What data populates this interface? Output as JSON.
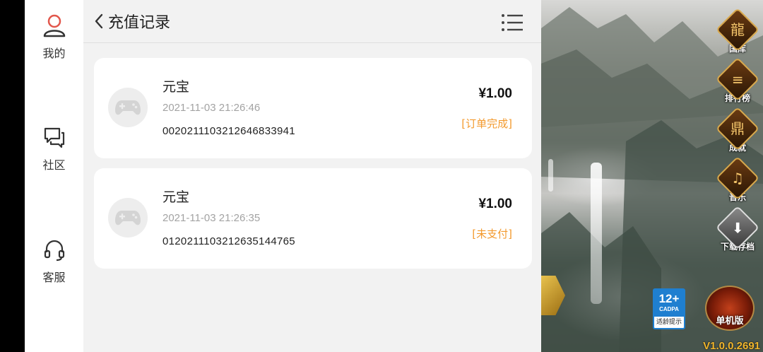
{
  "sidebar": {
    "items": [
      {
        "label": "我的",
        "icon": "user-icon"
      },
      {
        "label": "社区",
        "icon": "chat-icon"
      },
      {
        "label": "客服",
        "icon": "headset-icon"
      }
    ]
  },
  "header": {
    "title": "充值记录",
    "back_icon": "chevron-left-icon",
    "menu_icon": "list-menu-icon"
  },
  "records": [
    {
      "name": "元宝",
      "time": "2021-11-03 21:26:46",
      "order_no": "002021110321264 6833941",
      "amount": "¥1.00",
      "status": "[订单完成]"
    },
    {
      "name": "元宝",
      "time": "2021-11-03 21:26:35",
      "order_no": "012021110321263 5144765",
      "amount": "¥1.00",
      "status": "[未支付]"
    }
  ],
  "game_panel": {
    "buttons": [
      {
        "label": "国库",
        "icon": "treasury-icon"
      },
      {
        "label": "排行榜",
        "icon": "rank-icon"
      },
      {
        "label": "成就",
        "icon": "achievement-icon"
      },
      {
        "label": "音乐",
        "icon": "music-icon"
      },
      {
        "label": "下载存档",
        "icon": "download-icon"
      }
    ],
    "age_rating": "12+",
    "age_org": "CADPA",
    "age_tip": "适龄提示",
    "standalone_label": "单机版",
    "version": "V1.0.0.2691"
  },
  "colors": {
    "status_orange": "#f39a2e",
    "page_bg": "#f2f2f2",
    "card_bg": "#ffffff",
    "gold": "#f0b52c"
  }
}
